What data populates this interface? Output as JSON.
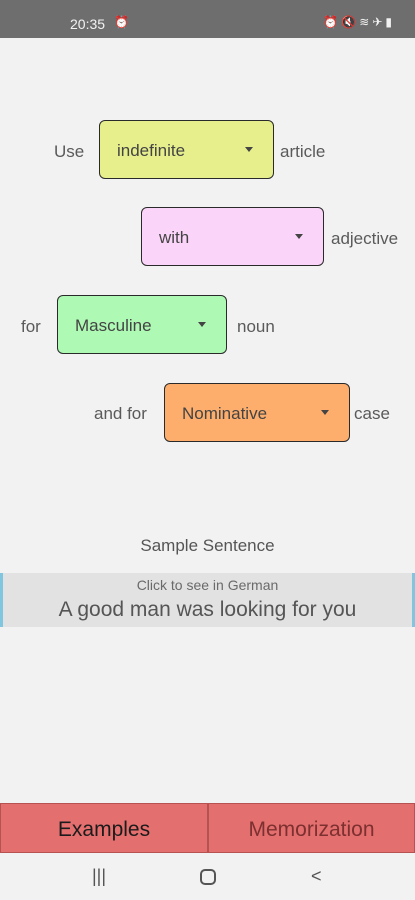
{
  "status_bar": {
    "time": "20:35",
    "alarm_icon": "alarm-icon",
    "right_icons": [
      "alarm-icon",
      "mute-icon",
      "wifi-icon",
      "airplane-icon",
      "battery-icon"
    ]
  },
  "rule": {
    "row1": {
      "prefix": "Use",
      "select": "indefinite",
      "suffix": "article"
    },
    "row2": {
      "select": "with",
      "suffix": "adjective"
    },
    "row3": {
      "prefix": "for",
      "select": "Masculine",
      "suffix": "noun"
    },
    "row4": {
      "prefix": "and for",
      "select": "Nominative",
      "suffix": "case"
    }
  },
  "colors": {
    "row1": "#e6ef8c",
    "row2": "#fbd5f9",
    "row3": "#aef9b4",
    "row4": "#fdae6d",
    "tab_bg": "#e46f6f",
    "accent": "#7fc6de"
  },
  "sample": {
    "title": "Sample Sentence",
    "hint": "Click to see in German",
    "sentence": "A good man was looking for you"
  },
  "tabs": {
    "examples": "Examples",
    "memorization": "Memorization"
  },
  "nav": {
    "recents": "|||",
    "back": "<"
  }
}
